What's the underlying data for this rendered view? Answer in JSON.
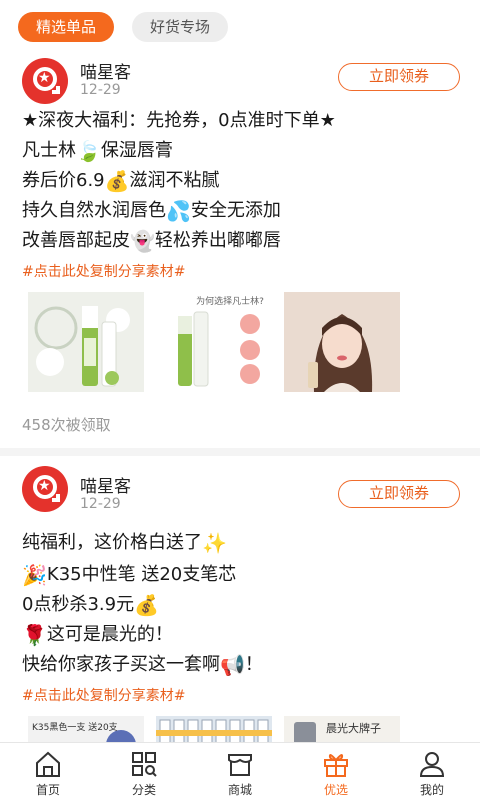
{
  "tabs": [
    "精选单品",
    "好货专场"
  ],
  "posts": [
    {
      "author": "喵星客",
      "date": "12-29",
      "coupon_button": "立即领券",
      "lines": {
        "l1": "★深夜大福利：先抢券，0点准时下单★",
        "l2a": "凡士林",
        "l2b": "保湿唇膏",
        "l3a": "券后价6.9",
        "l3b": "滋润不粘腻",
        "l4a": "持久自然水润唇色",
        "l4b": "安全无添加",
        "l5a": "改善唇部起皮",
        "l5b": "轻松养出嘟嘟唇"
      },
      "share_tag": "#点击此处复制分享素材#",
      "images": {
        "img2_title": "为何选择凡士林?"
      },
      "claimed": "458次被领取"
    },
    {
      "author": "喵星客",
      "date": "12-29",
      "coupon_button": "立即领券",
      "lines": {
        "l1": "纯福利，这价格白送了",
        "l2": "K35中性笔 送20支笔芯",
        "l3": "0点秒杀3.9元",
        "l4": "这可是晨光的！",
        "l5a": "快给你家孩子买这一套啊",
        "l5b": "！"
      },
      "share_tag": "#点击此处复制分享素材#",
      "images": {
        "img1_label": "K35黑色一支 送20支",
        "img3_label": "晨光大牌子"
      }
    }
  ],
  "bottom_nav": [
    "首页",
    "分类",
    "商城",
    "优选",
    "我的"
  ],
  "active_nav": "优选",
  "colors": {
    "accent": "#f4691e",
    "brand_red": "#e4322c"
  },
  "icons": [
    "leaf-emoji",
    "money-bag-emoji",
    "droplets-emoji",
    "ghost-emoji",
    "sparkles-emoji",
    "party-popper-emoji",
    "rose-emoji",
    "megaphone-emoji",
    "home-icon",
    "category-icon",
    "store-icon",
    "gift-icon",
    "user-icon"
  ]
}
